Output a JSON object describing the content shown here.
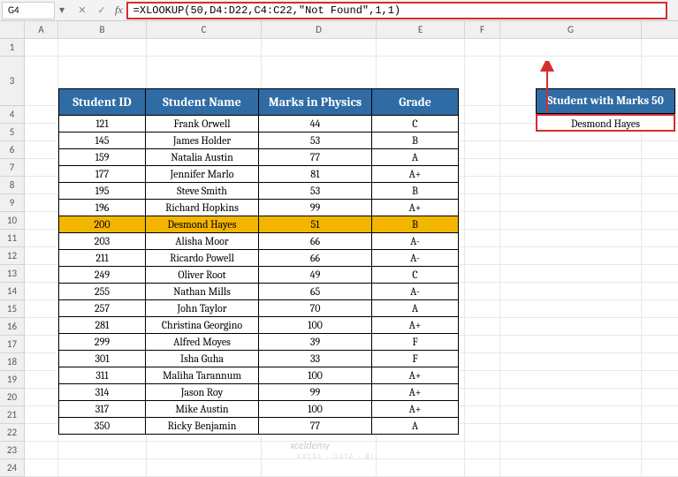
{
  "namebox": {
    "cell_ref": "G4"
  },
  "formula_bar": {
    "formula": "=XLOOKUP(50,D4:D22,C4:C22,\"Not Found\",1,1)"
  },
  "columns": [
    "A",
    "B",
    "C",
    "D",
    "E",
    "F",
    "G"
  ],
  "rows": [
    "1",
    "3",
    "4",
    "5",
    "6",
    "7",
    "8",
    "9",
    "10",
    "11",
    "12",
    "13",
    "14",
    "15",
    "16",
    "17",
    "18",
    "19",
    "20",
    "21",
    "22",
    "23",
    "24"
  ],
  "table": {
    "headers": [
      "Student ID",
      "Student Name",
      "Marks in Physics",
      "Grade"
    ],
    "rows": [
      {
        "id": "121",
        "name": "Frank Orwell",
        "marks": "44",
        "grade": "C",
        "hl": false
      },
      {
        "id": "145",
        "name": "James Holder",
        "marks": "53",
        "grade": "B",
        "hl": false
      },
      {
        "id": "159",
        "name": "Natalia Austin",
        "marks": "77",
        "grade": "A",
        "hl": false
      },
      {
        "id": "177",
        "name": "Jennifer Marlo",
        "marks": "81",
        "grade": "A+",
        "hl": false
      },
      {
        "id": "195",
        "name": "Steve Smith",
        "marks": "53",
        "grade": "B",
        "hl": false
      },
      {
        "id": "196",
        "name": "Richard Hopkins",
        "marks": "99",
        "grade": "A+",
        "hl": false
      },
      {
        "id": "200",
        "name": "Desmond Hayes",
        "marks": "51",
        "grade": "B",
        "hl": true
      },
      {
        "id": "203",
        "name": "Alisha Moor",
        "marks": "66",
        "grade": "A-",
        "hl": false
      },
      {
        "id": "211",
        "name": "Ricardo Powell",
        "marks": "66",
        "grade": "A-",
        "hl": false
      },
      {
        "id": "249",
        "name": "Oliver Root",
        "marks": "49",
        "grade": "C",
        "hl": false
      },
      {
        "id": "255",
        "name": "Nathan Mills",
        "marks": "65",
        "grade": "A-",
        "hl": false
      },
      {
        "id": "257",
        "name": "John Taylor",
        "marks": "70",
        "grade": "A",
        "hl": false
      },
      {
        "id": "281",
        "name": "Christina Georgino",
        "marks": "100",
        "grade": "A+",
        "hl": false
      },
      {
        "id": "299",
        "name": "Alfred Moyes",
        "marks": "39",
        "grade": "F",
        "hl": false
      },
      {
        "id": "301",
        "name": "Isha Guha",
        "marks": "33",
        "grade": "F",
        "hl": false
      },
      {
        "id": "311",
        "name": "Maliha Tarannum",
        "marks": "100",
        "grade": "A+",
        "hl": false
      },
      {
        "id": "314",
        "name": "Jason Roy",
        "marks": "99",
        "grade": "A+",
        "hl": false
      },
      {
        "id": "317",
        "name": "Mike Austin",
        "marks": "100",
        "grade": "A+",
        "hl": false
      },
      {
        "id": "350",
        "name": "Ricky Benjamin",
        "marks": "77",
        "grade": "A",
        "hl": false
      }
    ]
  },
  "result": {
    "header": "Student with Marks 50",
    "value": "Desmond Hayes"
  },
  "watermark": {
    "line1": "xceldemy",
    "line2": "EXCEL · DATA · BI"
  }
}
